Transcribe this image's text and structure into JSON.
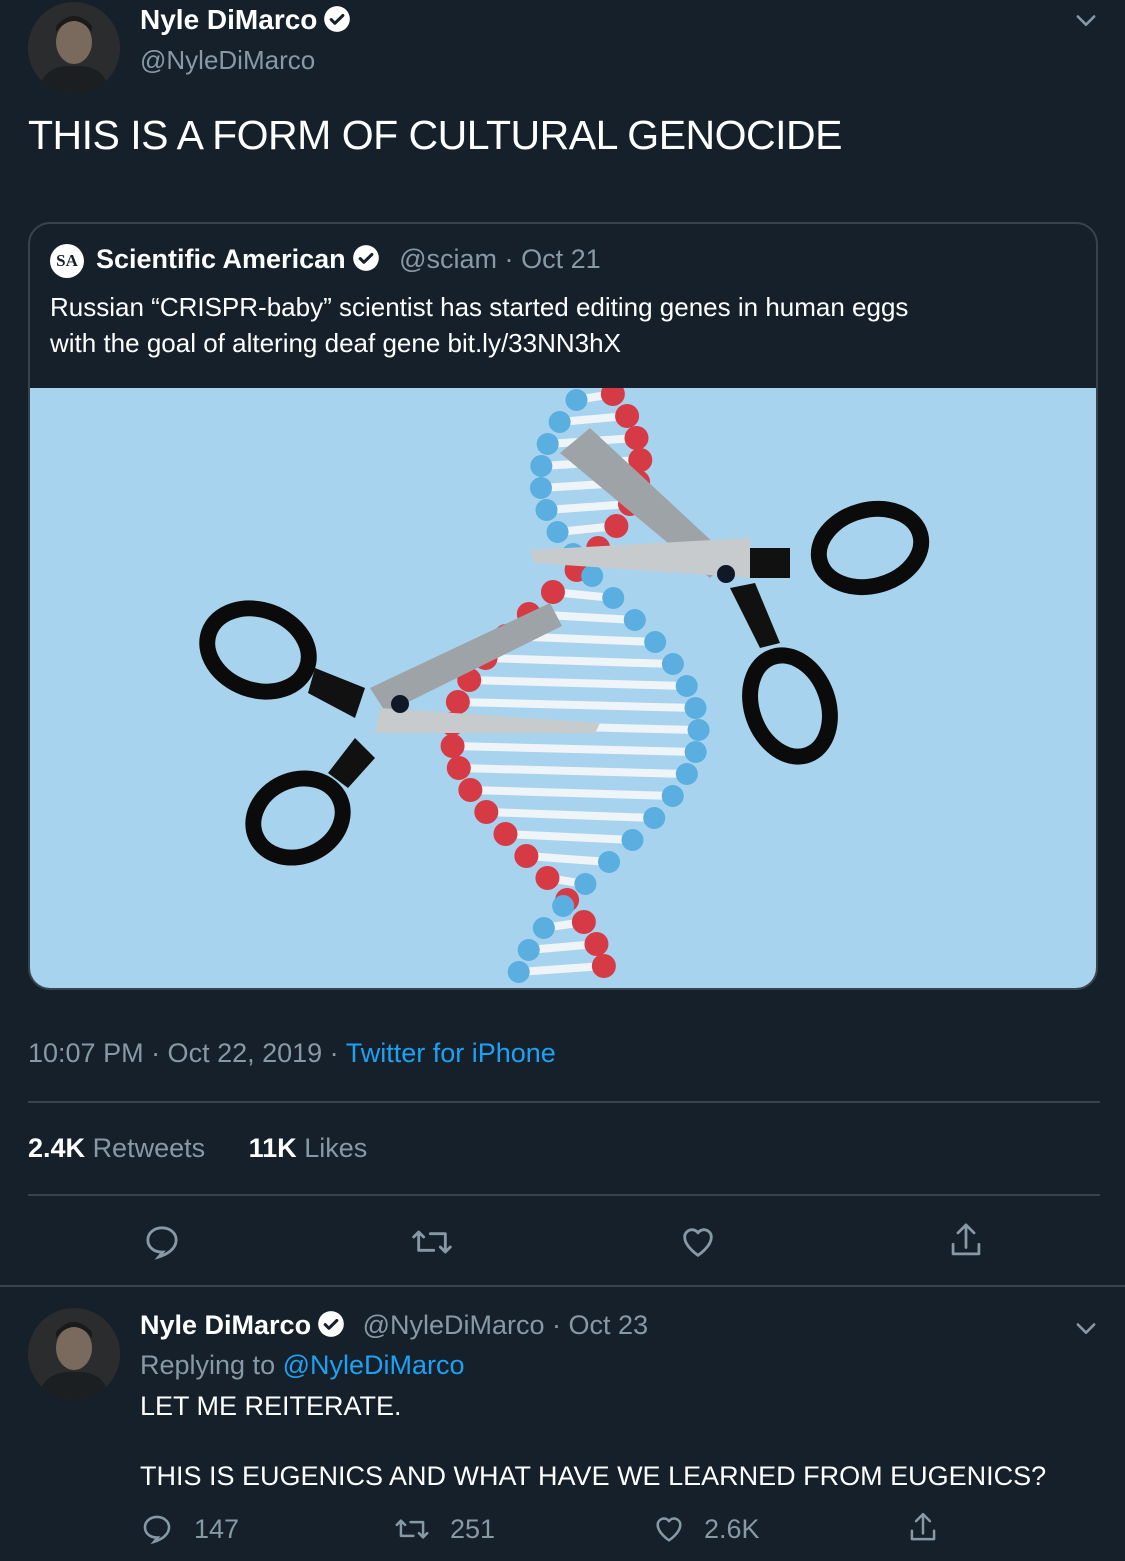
{
  "main_tweet": {
    "author_name": "Nyle DiMarco",
    "author_handle": "@NyleDiMarco",
    "text": "THIS IS A FORM OF CULTURAL GENOCIDE",
    "quoted": {
      "source_logo_text": "SA",
      "author_name": "Scientific American",
      "author_handle": "@sciam",
      "separator": "·",
      "date": "Oct 21",
      "text_line1": "Russian “CRISPR-baby” scientist has started editing genes in human eggs",
      "text_line2": "with the goal of altering deaf gene bit.ly/33NN3hX"
    },
    "timestamp": "10:07 PM · Oct 22, 2019 ·",
    "client": "Twitter for iPhone",
    "retweets_count": "2.4K",
    "retweets_label": "Retweets",
    "likes_count": "11K",
    "likes_label": "Likes"
  },
  "reply_tweet": {
    "author_name": "Nyle DiMarco",
    "author_handle": "@NyleDiMarco",
    "separator": "·",
    "date": "Oct 23",
    "replying_label": "Replying to",
    "replying_handle": "@NyleDiMarco",
    "line1": "LET ME REITERATE.",
    "line2": "THIS IS EUGENICS AND WHAT HAVE WE LEARNED FROM EUGENICS?",
    "reply_count": "147",
    "retweet_count": "251",
    "like_count": "2.6K"
  },
  "colors": {
    "background": "#15202b",
    "text_secondary": "#8899a6",
    "accent": "#1da1f2",
    "divider": "#38444d",
    "image_bg": "#a8d3ee",
    "dna_red": "#d63a45",
    "dna_blue": "#5aaee0"
  },
  "icons": [
    "verified-badge-icon",
    "chevron-down-icon",
    "reply-icon",
    "retweet-icon",
    "like-icon",
    "share-icon"
  ]
}
